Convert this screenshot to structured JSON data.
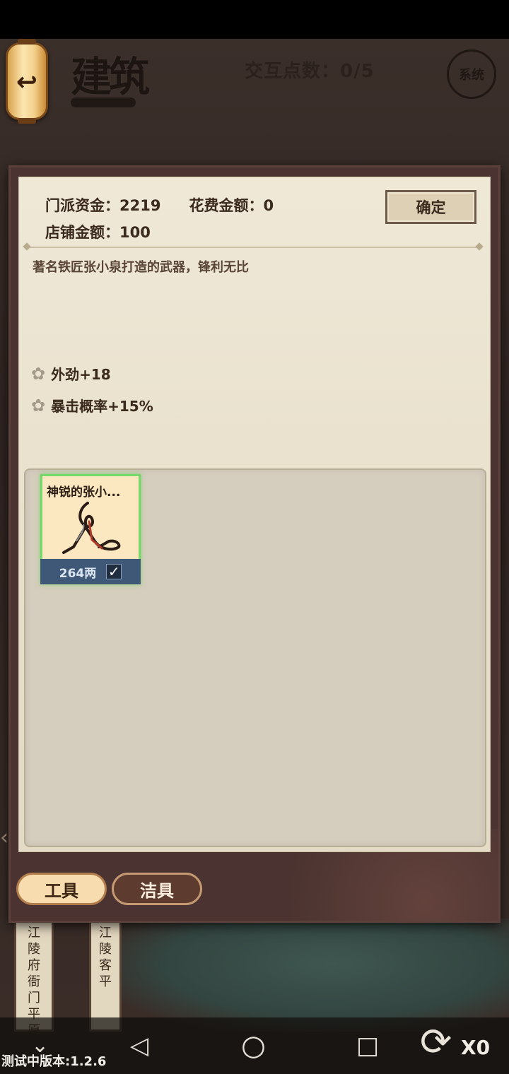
{
  "header": {
    "back_icon": "↩",
    "title": "建筑",
    "interact_points": "交互点数：0/5",
    "system_label": "系统"
  },
  "dialog": {
    "sect_funds": "门派资金：2219",
    "cost": "花费金额：0",
    "shop_funds": "店铺金额：100",
    "confirm_label": "确定",
    "description": "著名铁匠张小泉打造的武器，锋利无比",
    "attributes": [
      "外劲+18",
      "暴击概率+15%"
    ],
    "items": [
      {
        "name": "神锐的张小...",
        "price": "264两",
        "selected": true,
        "icon": "scissors-icon"
      }
    ],
    "tabs": [
      "工具",
      "洁具"
    ]
  },
  "background": {
    "left_sign": [
      "江",
      "陵",
      "府",
      "衙",
      "门",
      "平",
      "原"
    ],
    "right_sign": [
      "江",
      "陵",
      "客",
      "平"
    ]
  },
  "bottom": {
    "version": "测试中版本:1.2.6",
    "refresh_count": "X0",
    "nav": {
      "back": "◁",
      "home": "○",
      "recent": "□",
      "down": "⌄"
    }
  },
  "colors": {
    "selected_border": "#74d86a",
    "price_bar": "#3f5878",
    "tab_active": "#f6dcae",
    "tab_inactive": "#5d3b2f"
  }
}
